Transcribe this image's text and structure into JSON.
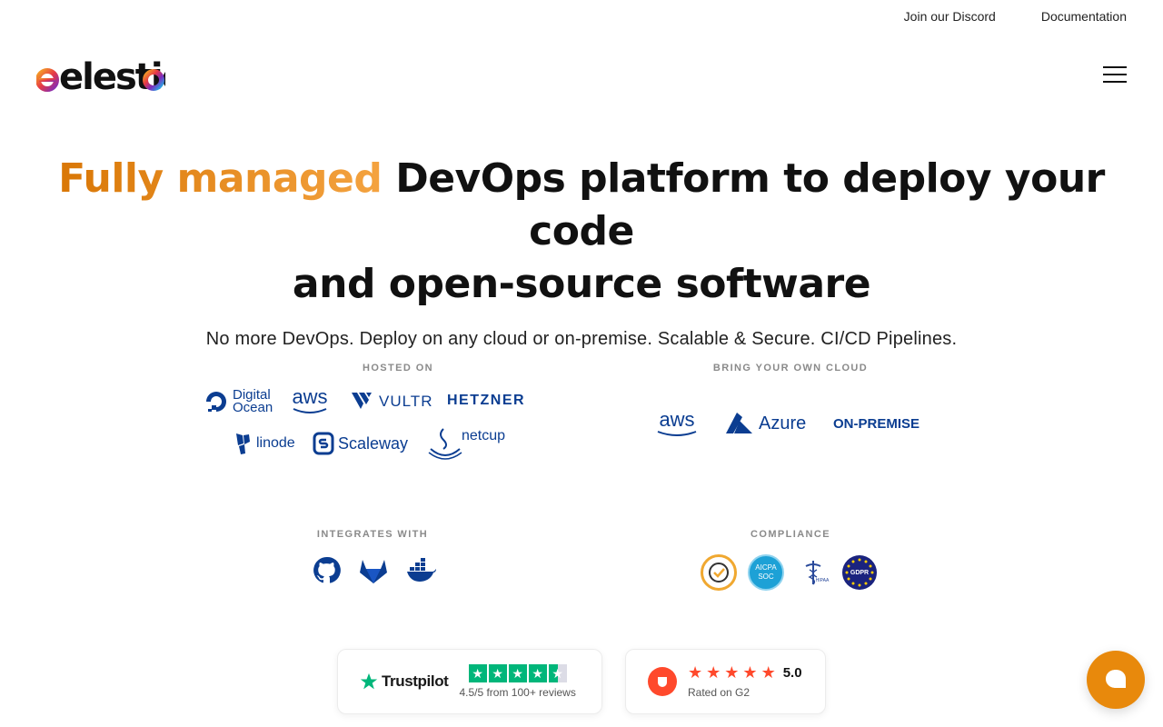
{
  "topnav": {
    "discord": "Join our Discord",
    "docs": "Documentation"
  },
  "logo": {
    "text": "elestio"
  },
  "hero": {
    "title_accent": "Fully managed",
    "title_rest": " DevOps platform to deploy your code",
    "title_line2": "and open-source software",
    "subtitle": "No more DevOps. Deploy on any cloud or on-premise. Scalable & Secure. CI/CD Pipelines."
  },
  "hosted_on": {
    "label": "HOSTED ON",
    "providers": [
      "Digital",
      "Ocean",
      "aws",
      "VULTR",
      "HETZNER",
      "linode",
      "Scaleway",
      "netcup"
    ]
  },
  "byoc": {
    "label": "BRING YOUR OWN CLOUD",
    "providers": [
      "aws",
      "Azure",
      "ON-PREMISE"
    ]
  },
  "integrates": {
    "label": "INTEGRATES WITH",
    "icons": [
      "github-icon",
      "gitlab-icon",
      "docker-icon"
    ]
  },
  "compliance": {
    "label": "COMPLIANCE",
    "aicpa_line1": "AICPA",
    "aicpa_line2": "SOC",
    "hipaa": "HIPAA",
    "gdpr": "GDPR"
  },
  "trustpilot": {
    "brand": "Trustpilot",
    "rating_text": "4.5/5 from 100+ reviews",
    "stars": 4.5
  },
  "g2": {
    "score": "5.0",
    "caption": "Rated on G2",
    "stars": 5
  },
  "colors": {
    "accent_start": "#d97706",
    "accent_end": "#f4a340",
    "trustpilot_green": "#00b67a",
    "g2_red": "#ff492c",
    "chat_orange": "#e8890c",
    "brand_blue": "#0b3d91"
  }
}
